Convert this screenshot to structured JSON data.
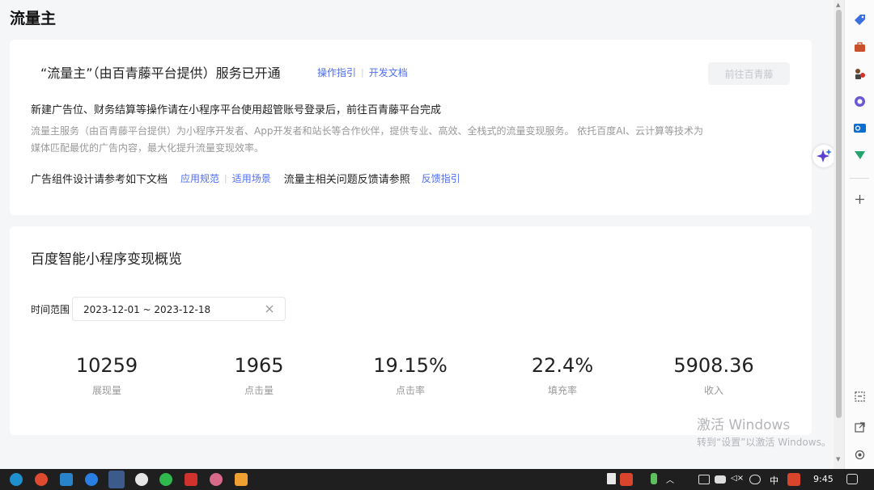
{
  "page": {
    "title": "流量主"
  },
  "service": {
    "title": "“流量主”（由百青藤平台提供）服务已开通",
    "guide_link": "操作指引",
    "doc_link": "开发文档",
    "goto_button": "前往百青藤",
    "notice": "新建广告位、财务结算等操作请在小程序平台使用超管账号登录后，前往百青藤平台完成",
    "description": "流量主服务（由百青藤平台提供）为小程序开发者、App开发者和站长等合作伙伴，提供专业、高效、全栈式的流量变现服务。 依托百度AI、云计算等技术为媒体匹配最优的广告内容，最大化提升流量变现效率。",
    "doc_intro": "广告组件设计请参考如下文档",
    "spec_link": "应用规范",
    "scene_link": "适用场景",
    "feedback_intro": "流量主相关问题反馈请参照",
    "feedback_link": "反馈指引"
  },
  "overview": {
    "title": "百度智能小程序变现概览",
    "time_label": "时间范围",
    "date_range": "2023-12-01 ~ 2023-12-18",
    "metrics": [
      {
        "value": "10259",
        "label": "展现量"
      },
      {
        "value": "1965",
        "label": "点击量"
      },
      {
        "value": "19.15%",
        "label": "点击率"
      },
      {
        "value": "22.4%",
        "label": "填充率"
      },
      {
        "value": "5908.36",
        "label": "收入"
      }
    ]
  },
  "watermark": {
    "line1": "激活 Windows",
    "line2": "转到“设置”以激活 Windows。"
  },
  "taskbar": {
    "ime": "中",
    "time": "9:45"
  },
  "colors": {
    "link": "#4e6ef2",
    "muted": "#999999",
    "button_disabled_bg": "#f2f3f5"
  }
}
